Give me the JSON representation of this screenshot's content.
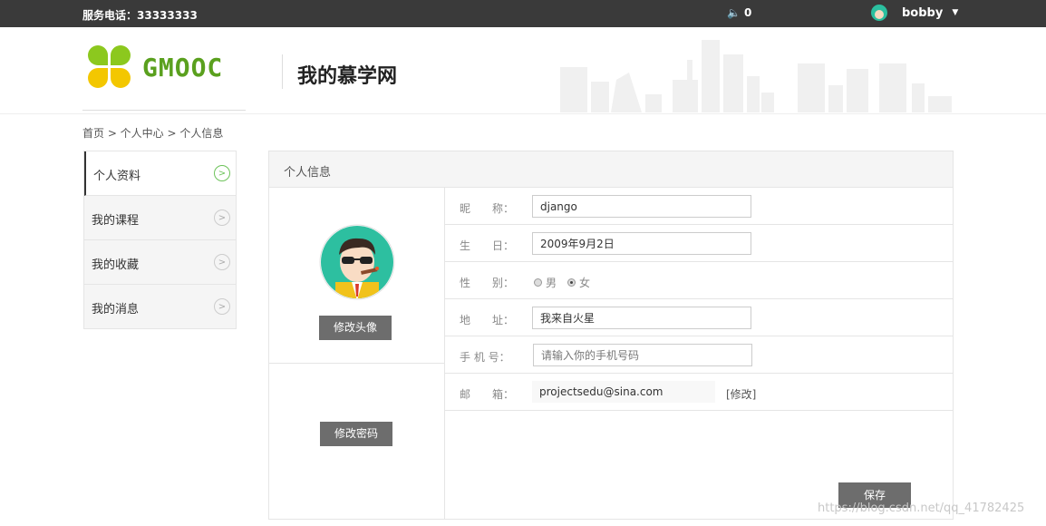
{
  "topbar": {
    "phone": "服务电话：33333333",
    "notify_count": "0",
    "user_name": "bobby"
  },
  "header": {
    "logo_text": "GMOOC",
    "site_title": "我的慕学网"
  },
  "breadcrumb": "首页 > 个人中心 > 个人信息",
  "sidebar": {
    "items": [
      {
        "label": "个人资料"
      },
      {
        "label": "我的课程"
      },
      {
        "label": "我的收藏"
      },
      {
        "label": "我的消息"
      }
    ]
  },
  "panel": {
    "title": "个人信息",
    "avatar_button": "修改头像",
    "password_button": "修改密码",
    "save_button": "保存"
  },
  "form": {
    "nickname_label": "昵　　称：",
    "nickname_value": "django",
    "birthday_label": "生　　日：",
    "birthday_value": "2009年9月2日",
    "gender_label": "性　　别：",
    "gender_male": "男",
    "gender_female": "女",
    "address_label": "地　　址：",
    "address_value": "我来自火星",
    "mobile_label": "手 机 号：",
    "mobile_placeholder": "请输入你的手机号码",
    "email_label": "邮　　箱：",
    "email_value": "projectsedu@sina.com",
    "email_edit": "[修改]"
  },
  "watermark": "https://blog.csdn.net/qq_41782425",
  "colors": {
    "topbar_bg": "#3a3a3a",
    "accent_green": "#5aa01e",
    "button_gray": "#6d6d6d"
  }
}
